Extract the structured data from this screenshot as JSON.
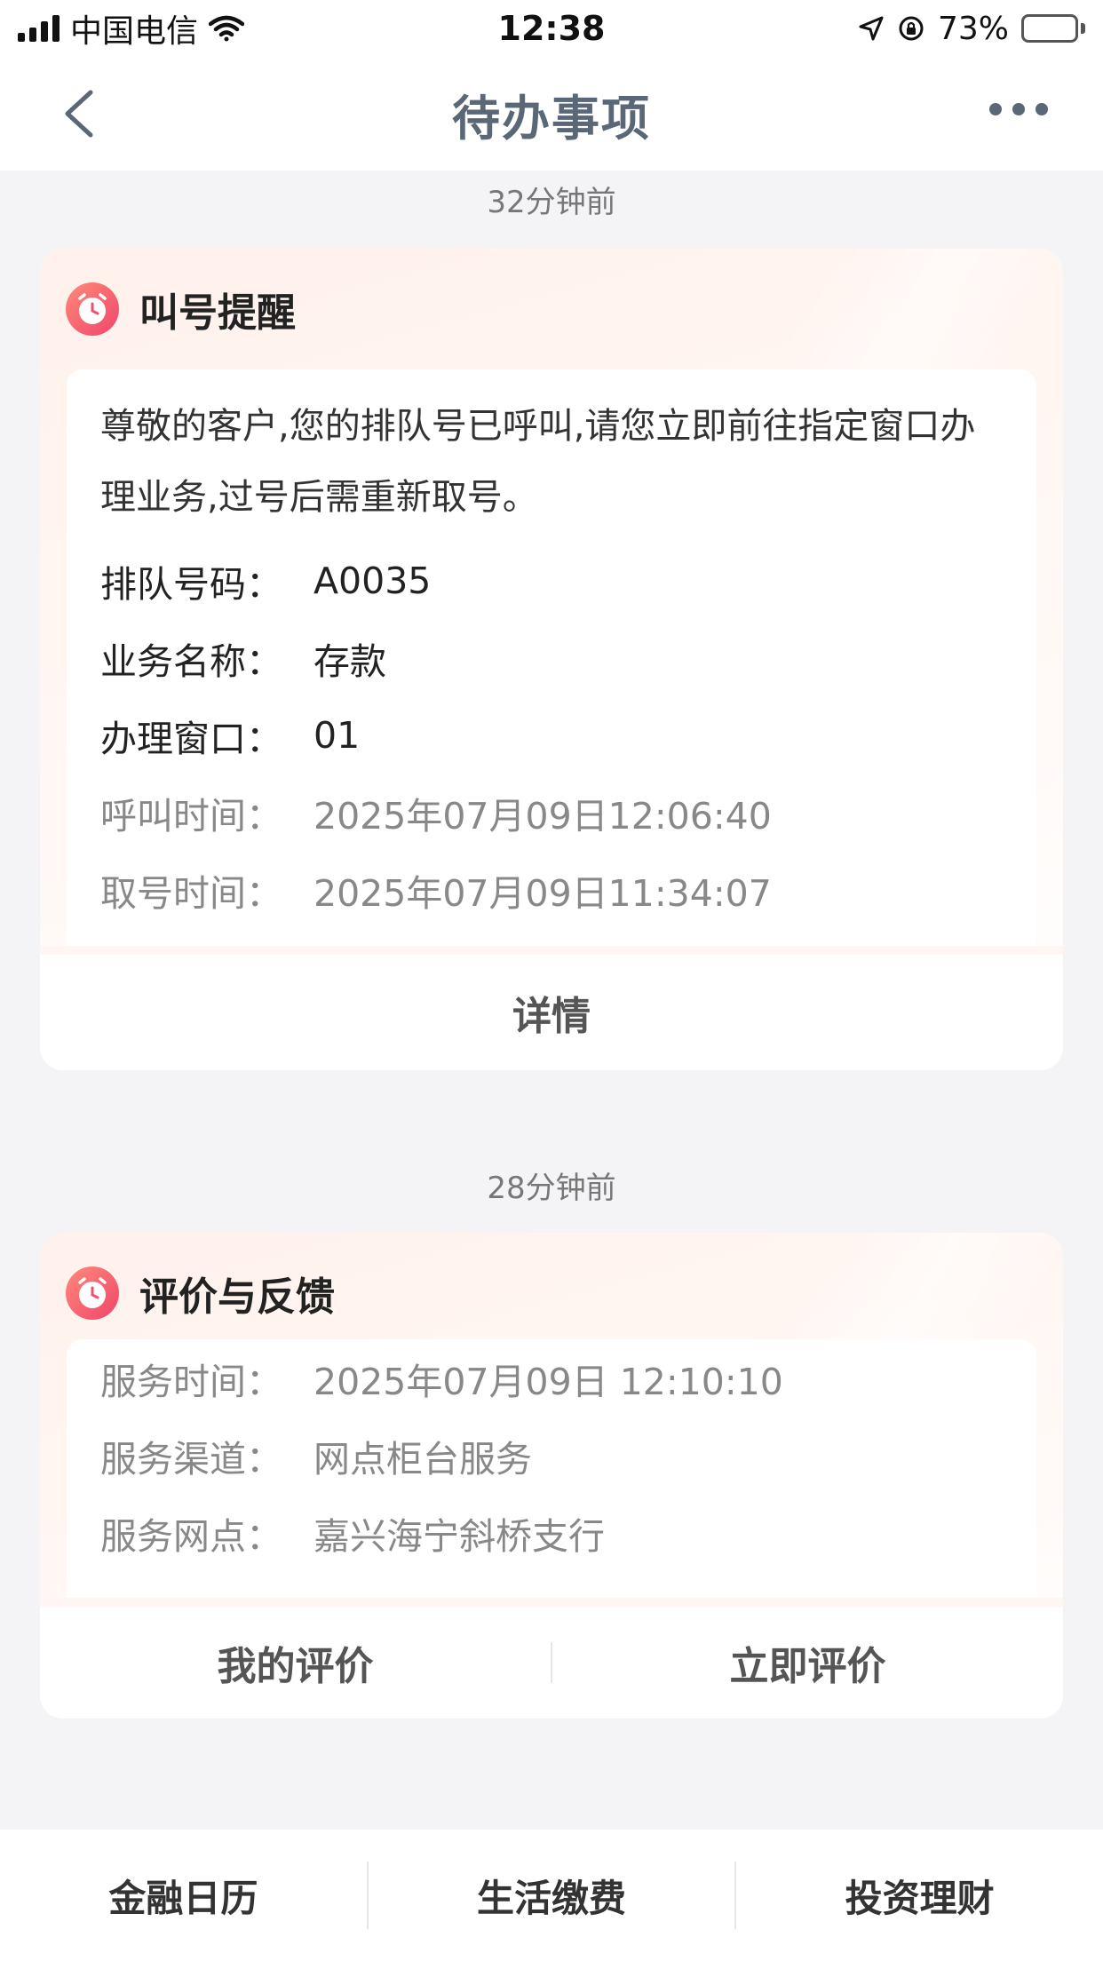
{
  "status_bar": {
    "carrier": "中国电信",
    "time": "12:38",
    "battery": "73%",
    "battery_level": 0.73
  },
  "header": {
    "title": "待办事项",
    "back_icon": "chevron-left-icon",
    "more_icon": "more-dots-icon"
  },
  "cards": [
    {
      "timestamp": "32分钟前",
      "title": "叫号提醒",
      "icon": "alarm-clock-icon",
      "message": "尊敬的客户,您的排队号已呼叫,请您立即前往指定窗口办理业务,过号后需重新取号。",
      "fields": [
        {
          "label": "排队号码：",
          "value": "A0035"
        },
        {
          "label": "业务名称：",
          "value": "存款"
        },
        {
          "label": "办理窗口：",
          "value": "01"
        },
        {
          "label": "呼叫时间：",
          "value": "2025年07月09日12:06:40"
        },
        {
          "label": "取号时间：",
          "value": "2025年07月09日11:34:07"
        }
      ],
      "button": "详情"
    },
    {
      "timestamp": "28分钟前",
      "title": "评价与反馈",
      "icon": "alarm-clock-icon",
      "fields": [
        {
          "label": "服务时间：",
          "value": "2025年07月09日 12:10:10"
        },
        {
          "label": "服务渠道：",
          "value": "网点柜台服务"
        },
        {
          "label": "服务网点：",
          "value": "嘉兴海宁斜桥支行"
        }
      ],
      "buttons": [
        "我的评价",
        "立即评价"
      ]
    }
  ],
  "tab_bar": [
    "金融日历",
    "生活缴费",
    "投资理财"
  ],
  "colors": {
    "accent": "#f0506e",
    "nav_title": "#5a6776",
    "battery_green": "#35c759",
    "background": "#f4f4f6"
  }
}
